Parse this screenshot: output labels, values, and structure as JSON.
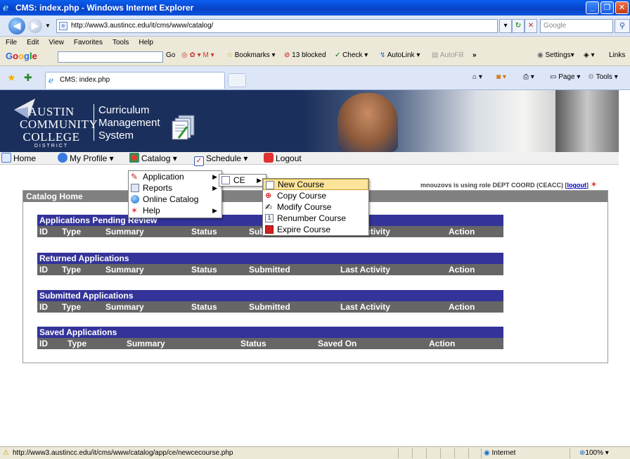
{
  "window": {
    "title": "CMS: index.php - Windows Internet Explorer"
  },
  "address": {
    "url": "http://www3.austincc.edu/it/cms/www/catalog/",
    "search_placeholder": "Google"
  },
  "menubar": [
    "File",
    "Edit",
    "View",
    "Favorites",
    "Tools",
    "Help"
  ],
  "google_toolbar": {
    "logo": "Google",
    "go": "Go",
    "bookmarks": "Bookmarks",
    "blocked": "13 blocked",
    "check": "Check",
    "autolink": "AutoLink",
    "autofill": "AutoFill",
    "settings": "Settings",
    "links": "Links"
  },
  "tab": {
    "label": "CMS: index.php"
  },
  "commandbar": {
    "page": "Page",
    "tools": "Tools"
  },
  "banner": {
    "logo_line1": "AUSTIN",
    "logo_line2": "COMMUNITY",
    "logo_line3": "COLLEGE",
    "logo_line4": "DISTRICT",
    "cms_line1": "Curriculum",
    "cms_line2": "Management",
    "cms_line3": "System"
  },
  "nav": {
    "home": "Home",
    "profile": "My Profile",
    "catalog": "Catalog",
    "schedule": "Schedule",
    "logout": "Logout"
  },
  "catalog_menu": [
    "Application",
    "Reports",
    "Online Catalog",
    "Help"
  ],
  "application_menu": [
    "CE"
  ],
  "ce_menu": [
    "New Course",
    "Copy Course",
    "Modify Course",
    "Renumber Course",
    "Expire Course"
  ],
  "user": {
    "text": "mnouzovs is using role DEPT COORD (CEACC) [",
    "logout": "logout",
    "close": "]"
  },
  "panel": {
    "title": "Catalog Home"
  },
  "tables": [
    {
      "caption": "Applications Pending Review",
      "columns": [
        "ID",
        "Type",
        "Summary",
        "Status",
        "Submitted",
        "Last Activity",
        "Action"
      ]
    },
    {
      "caption": "Returned Applications",
      "columns": [
        "ID",
        "Type",
        "Summary",
        "Status",
        "Submitted",
        "Last Activity",
        "Action"
      ]
    },
    {
      "caption": "Submitted Applications",
      "columns": [
        "ID",
        "Type",
        "Summary",
        "Status",
        "Submitted",
        "Last Activity",
        "Action"
      ]
    },
    {
      "caption": "Saved Applications",
      "columns": [
        "ID",
        "Type",
        "Summary",
        "Status",
        "Saved On",
        "Action"
      ]
    }
  ],
  "status": {
    "url": "http://www3.austincc.edu/it/cms/www/catalog/app/ce/newcecourse.php",
    "zone": "Internet",
    "zoom": "100%"
  }
}
